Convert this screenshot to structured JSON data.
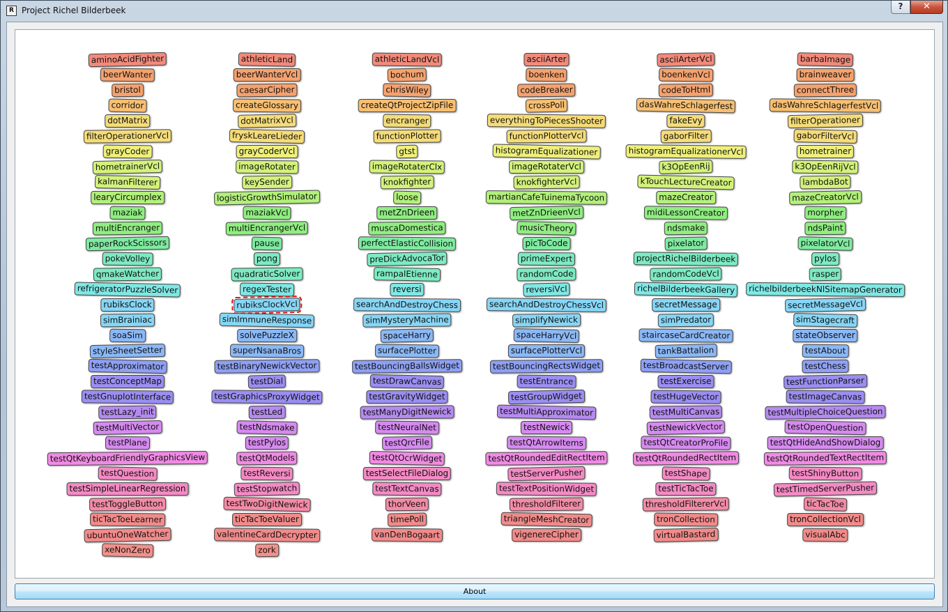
{
  "window": {
    "title": "Project Richel Bilderbeek",
    "icon_text": "R",
    "help_label": "?",
    "close_label": "✕"
  },
  "about_button": {
    "label": "About"
  },
  "selected": "rubiksClockVcl",
  "columns": [
    [
      "aminoAcidFighter",
      "beerWanter",
      "bristol",
      "corridor",
      "dotMatrix",
      "filterOperationerVcl",
      "grayCoder",
      "hometrainerVcl",
      "kalmanFilterer",
      "learyCircumplex",
      "maziak",
      "multiEncranger",
      "paperRockScissors",
      "pokeVolley",
      "qmakeWatcher",
      "refrigeratorPuzzleSolver",
      "rubiksClock",
      "simBrainiac",
      "soaSim",
      "styleSheetSetter",
      "testApproximator",
      "testConceptMap",
      "testGnuplotInterface",
      "testLazy_init",
      "testMultiVector",
      "testPlane",
      "testQtKeyboardFriendlyGraphicsView",
      "testQuestion",
      "testSimpleLinearRegression",
      "testToggleButton",
      "ticTacToeLearner",
      "ubuntuOneWatcher",
      "xeNonZero"
    ],
    [
      "athleticLand",
      "beerWanterVcl",
      "caesarCipher",
      "createGlossary",
      "dotMatrixVcl",
      "fryskLeareLieder",
      "grayCoderVcl",
      "imageRotater",
      "keySender",
      "logisticGrowthSimulator",
      "maziakVcl",
      "multiEncrangerVcl",
      "pause",
      "pong",
      "quadraticSolver",
      "regexTester",
      "rubiksClockVcl",
      "simImmuneResponse",
      "solvePuzzleX",
      "superNsanaBros",
      "testBinaryNewickVector",
      "testDial",
      "testGraphicsProxyWidget",
      "testLed",
      "testNdsmake",
      "testPylos",
      "testQtModels",
      "testReversi",
      "testStopwatch",
      "testTwoDigitNewick",
      "ticTacToeValuer",
      "valentineCardDecrypter",
      "zork"
    ],
    [
      "athleticLandVcl",
      "bochum",
      "chrisWiley",
      "createQtProjectZipFile",
      "encranger",
      "functionPlotter",
      "gtst",
      "imageRotaterClx",
      "knokfighter",
      "loose",
      "metZnDrieen",
      "muscaDomestica",
      "perfectElasticCollision",
      "preDickAdvocaTor",
      "rampalEtienne",
      "reversi",
      "searchAndDestroyChess",
      "simMysteryMachine",
      "spaceHarry",
      "surfacePlotter",
      "testBouncingBallsWidget",
      "testDrawCanvas",
      "testGravityWidget",
      "testManyDigitNewick",
      "testNeuralNet",
      "testQrcFile",
      "testQtOcrWidget",
      "testSelectFileDialog",
      "testTextCanvas",
      "thorVeen",
      "timePoll",
      "vanDenBogaart"
    ],
    [
      "asciiArter",
      "boenken",
      "codeBreaker",
      "crossPoll",
      "everythingToPiecesShooter",
      "functionPlotterVcl",
      "histogramEqualizationer",
      "imageRotaterVcl",
      "knokfighterVcl",
      "martianCafeTuinemaTycoon",
      "metZnDrieenVcl",
      "musicTheory",
      "picToCode",
      "primeExpert",
      "randomCode",
      "reversiVcl",
      "searchAndDestroyChessVcl",
      "simplifyNewick",
      "spaceHarryVcl",
      "surfacePlotterVcl",
      "testBouncingRectsWidget",
      "testEntrance",
      "testGroupWidget",
      "testMultiApproximator",
      "testNewick",
      "testQtArrowItems",
      "testQtRoundedEditRectItem",
      "testServerPusher",
      "testTextPositionWidget",
      "thresholdFilterer",
      "triangleMeshCreator",
      "vigenereCipher"
    ],
    [
      "asciiArterVcl",
      "boenkenVcl",
      "codeToHtml",
      "dasWahreSchlagerfest",
      "fakeEvy",
      "gaborFilter",
      "histogramEqualizationerVcl",
      "k3OpEenRij",
      "kTouchLectureCreator",
      "mazeCreator",
      "midiLessonCreator",
      "ndsmake",
      "pixelator",
      "projectRichelBilderbeek",
      "randomCodeVcl",
      "richelBilderbeekGallery",
      "secretMessage",
      "simPredator",
      "staircaseCardCreator",
      "tankBattalion",
      "testBroadcastServer",
      "testExercise",
      "testHugeVector",
      "testMultiCanvas",
      "testNewickVector",
      "testQtCreatorProFile",
      "testQtRoundedRectItem",
      "testShape",
      "testTicTacToe",
      "thresholdFiltererVcl",
      "tronCollection",
      "virtualBastard"
    ],
    [
      "barbaImage",
      "brainweaver",
      "connectThree",
      "dasWahreSchlagerfestVcl",
      "filterOperationer",
      "gaborFilterVcl",
      "hometrainer",
      "k3OpEenRijVcl",
      "lambdaBot",
      "mazeCreatorVcl",
      "morpher",
      "ndsPaint",
      "pixelatorVcl",
      "pylos",
      "rasper",
      "richelbilderbeekNlSitemapGenerator",
      "secretMessageVcl",
      "simStagecraft",
      "stateObserver",
      "testAbout",
      "testChess",
      "testFunctionParser",
      "testImageCanvas",
      "testMultipleChoiceQuestion",
      "testOpenQuestion",
      "testQtHideAndShowDialog",
      "testQtRoundedTextRectItem",
      "testShinyButton",
      "testTimedServerPusher",
      "ticTacToe",
      "tronCollectionVcl",
      "visualAbc"
    ]
  ],
  "palette": [
    "#f28a7a",
    "#f5a26e",
    "#f7bf72",
    "#f5dc78",
    "#eef07a",
    "#d3f27a",
    "#b2f07a",
    "#8fee80",
    "#7eeba0",
    "#7cebc2",
    "#7ee8e4",
    "#86d6f6",
    "#8bb8f6",
    "#8ea0f4",
    "#9a8ef2",
    "#b58af0",
    "#d68af0",
    "#f08ae4",
    "#f48ac4",
    "#f48aa6",
    "#f28a8a",
    "#f2908a"
  ]
}
